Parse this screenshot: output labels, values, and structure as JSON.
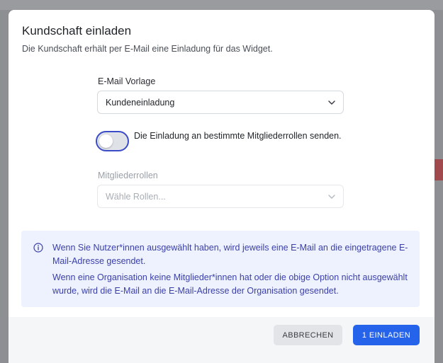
{
  "modal": {
    "title": "Kundschaft einladen",
    "subtitle": "Die Kundschaft erhält per E-Mail eine Einladung für das Widget."
  },
  "template": {
    "label": "E-Mail Vorlage",
    "value": "Kundeneinladung"
  },
  "toggle": {
    "label": "Die Einladung an bestimmte Mitgliederrollen senden.",
    "checked": false
  },
  "roles": {
    "label": "Mitgliederrollen",
    "placeholder": "Wähle Rollen...",
    "disabled": true
  },
  "info": {
    "line1": "Wenn Sie Nutzer*innen ausgewählt haben, wird jeweils eine E-Mail an die eingetragene E-Mail-Adresse gesendet.",
    "line2": "Wenn eine Organisation keine Mitglieder*innen hat oder die obige Option nicht ausgewählt wurde, wird die E-Mail an die E-Mail-Adresse der Organisation gesendet."
  },
  "footer": {
    "cancel_label": "ABBRECHEN",
    "submit_label": "1 EINLADEN"
  },
  "colors": {
    "primary": "#2563eb",
    "toggle_focus": "#3b4cc7",
    "info_bg": "#eef2ff",
    "info_text": "#3a3fa8"
  },
  "icons": {
    "select_chevron": "chevron-down-icon",
    "info": "info-circle-icon"
  }
}
